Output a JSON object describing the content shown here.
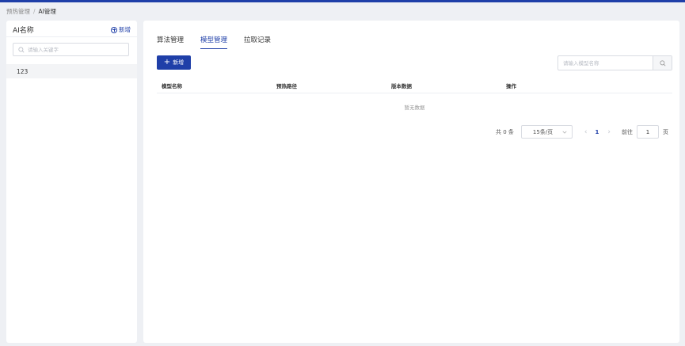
{
  "breadcrumb": {
    "parent": "预热管理",
    "separator": "/",
    "current": "AI管理"
  },
  "left_panel": {
    "title": "AI名称",
    "add_label": "新增",
    "search_placeholder": "请输入关键字",
    "items": [
      {
        "label": "123"
      }
    ]
  },
  "tabs": [
    {
      "label": "算法管理",
      "active": false
    },
    {
      "label": "模型管理",
      "active": true
    },
    {
      "label": "拉取记录",
      "active": false
    }
  ],
  "toolbar": {
    "add_label": "新增",
    "search_placeholder": "请输入模型名称"
  },
  "table": {
    "columns": [
      "模型名称",
      "预热路径",
      "版本数据",
      "操作"
    ],
    "empty_text": "暂无数据"
  },
  "pagination": {
    "total_text": "共 0 条",
    "page_size": "15条/页",
    "current_page": "1",
    "goto_label": "前往",
    "goto_value": "1",
    "page_suffix": "页"
  },
  "colors": {
    "accent": "#1f3fa8",
    "background": "#eef0f4",
    "panel": "#ffffff"
  }
}
